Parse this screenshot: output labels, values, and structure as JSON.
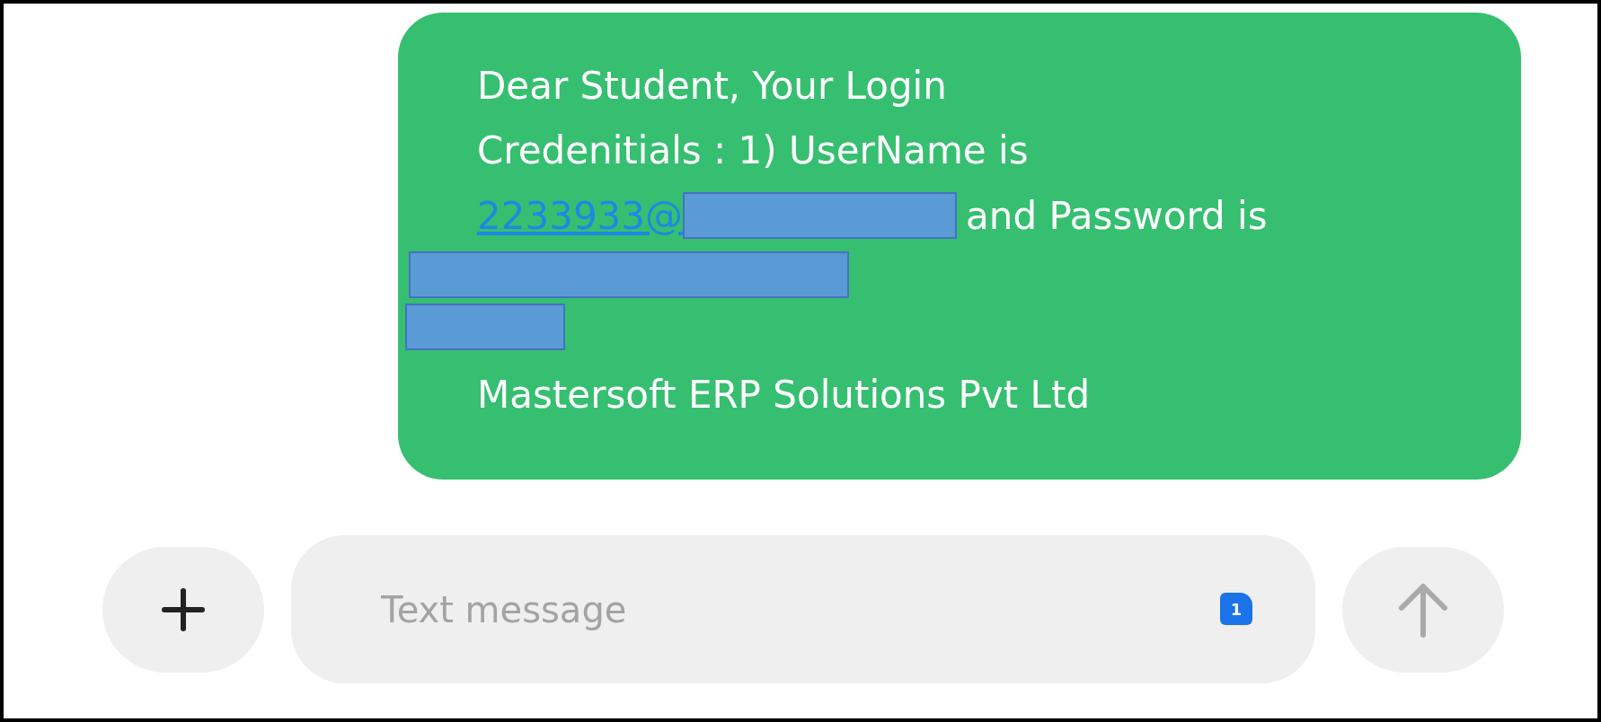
{
  "message": {
    "lines": [
      {
        "kind": "text",
        "text": "Dear Student, Your Login"
      },
      {
        "kind": "text",
        "text": "Credenitials : 1) UserName is"
      },
      {
        "kind": "link_redacted",
        "link": "2233933@",
        "text": "and Password is"
      },
      {
        "kind": "redacted_long"
      },
      {
        "kind": "redacted_short"
      },
      {
        "kind": "text",
        "text": "Mastersoft ERP Solutions Pvt Ltd"
      }
    ]
  },
  "composer": {
    "placeholder": "Text message",
    "sim_badge": "1"
  }
}
